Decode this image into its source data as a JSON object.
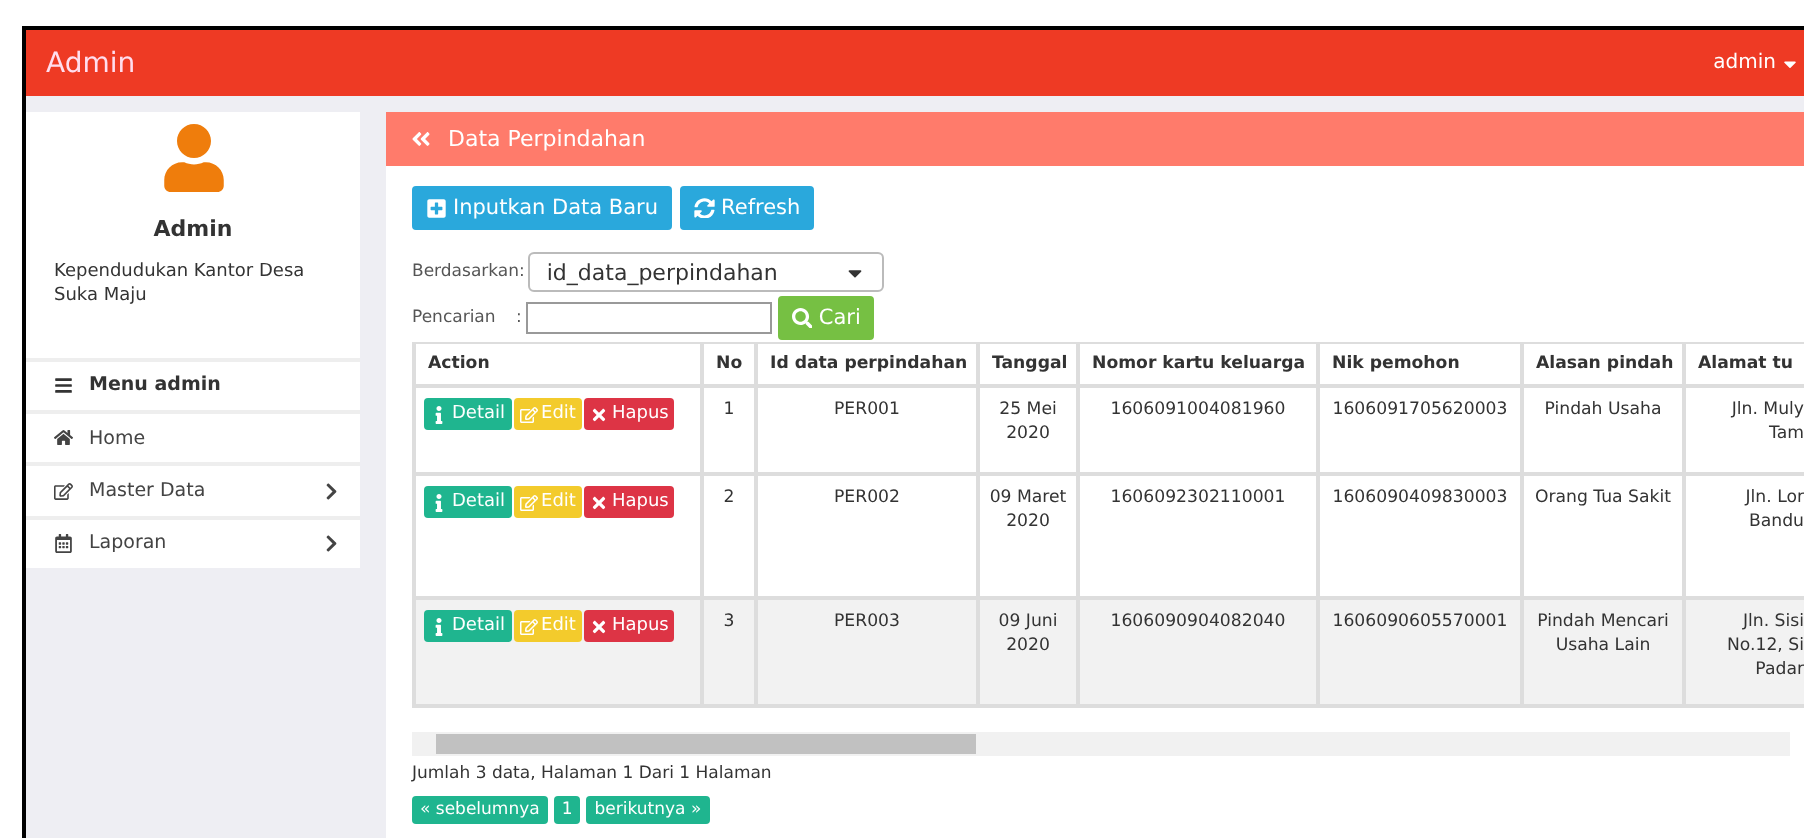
{
  "navbar": {
    "brand": "Admin",
    "user": "admin"
  },
  "sidebar": {
    "name": "Admin",
    "subtitle": "Kependudukan Kantor Desa Suka Maju",
    "menu_title": "Menu admin",
    "items": [
      {
        "label": "Home",
        "kind": "home",
        "submenu": false
      },
      {
        "label": "Master Data",
        "kind": "edit",
        "submenu": true
      },
      {
        "label": "Laporan",
        "kind": "calendar",
        "submenu": true
      }
    ]
  },
  "panel": {
    "title": "Data Perpindahan",
    "buttons": [
      {
        "kind": "add",
        "label": "Inputkan Data Baru"
      },
      {
        "kind": "refresh",
        "label": "Refresh"
      }
    ],
    "filter": {
      "label": "Berdasarkan:",
      "value": "id_data_perpindahan"
    },
    "search": {
      "label": "Pencarian",
      "separator": ":",
      "button": "Cari"
    },
    "table": {
      "columns": [
        "Action",
        "No",
        "Id data perpindahan",
        "Tanggal",
        "Nomor kartu keluarga",
        "Nik pemohon",
        "Alasan pindah",
        "Alamat tu"
      ],
      "rows": [
        {
          "selected": false,
          "cells": [
            {
              "actions": [
                {
                  "kind": "detail",
                  "label": "Detail"
                },
                {
                  "kind": "edit",
                  "label": "Edit"
                },
                {
                  "kind": "delete",
                  "label": "Hapus"
                }
              ]
            },
            "1",
            "PER001",
            "25 Mei 2020",
            "1606091004081960",
            "1606091705620003",
            "Pindah Usaha",
            "Jln. Muly Tam"
          ]
        },
        {
          "selected": false,
          "cells": [
            {
              "actions": [
                {
                  "kind": "detail",
                  "label": "Detail"
                },
                {
                  "kind": "edit",
                  "label": "Edit"
                },
                {
                  "kind": "delete",
                  "label": "Hapus"
                }
              ]
            },
            "2",
            "PER002",
            "09 Maret 2020",
            "1606092302110001",
            "1606090409830003",
            "Orang Tua Sakit",
            "Jln. Lor Bandu"
          ]
        },
        {
          "selected": true,
          "cells": [
            {
              "actions": [
                {
                  "kind": "detail",
                  "label": "Detail"
                },
                {
                  "kind": "edit",
                  "label": "Edit"
                },
                {
                  "kind": "delete",
                  "label": "Hapus"
                }
              ]
            },
            "3",
            "PER003",
            "09 Juni 2020",
            "1606090904082040",
            "1606090605570001",
            "Pindah Mencari Usaha Lain",
            "Jln. Sisi No.12, Si Padar"
          ]
        }
      ]
    },
    "summary": "Jumlah 3 data, Halaman 1 Dari 1 Halaman",
    "pagination": [
      {
        "label": "« sebelumnya"
      },
      {
        "label": "1"
      },
      {
        "label": "berikutnya »"
      }
    ]
  }
}
